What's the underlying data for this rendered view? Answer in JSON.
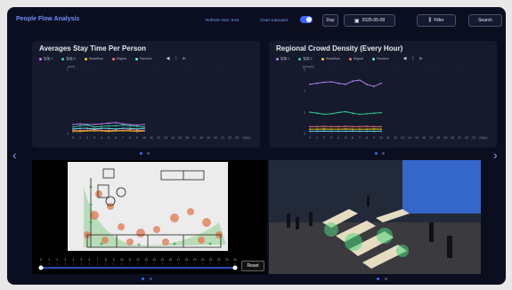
{
  "header": {
    "title": "People Flow Analysis",
    "refresh": "Refresh time: 5:54",
    "carousel_label": "Chart Carousel",
    "period": "Day",
    "date": "2025-05-08",
    "filter": "Filter",
    "search": "Search"
  },
  "colors": {
    "purple": "#c084fc",
    "green": "#34d399",
    "yellow": "#facc15",
    "red": "#f87171",
    "cyan": "#67e8f9",
    "accent": "#3a66ff"
  },
  "chart1": {
    "title": "Averages Stay Time Per Person",
    "legend": [
      "智能-1",
      "智能-2",
      "Smartflow",
      "Edgeai",
      "Pandora"
    ],
    "ylabel": "(min)",
    "xunit": "(hr)",
    "pager": "1"
  },
  "chart2": {
    "title": "Regional Crowd Density (Every Hour)",
    "legend": [
      "智能-1",
      "智能-2",
      "Smartflow",
      "Edgeai",
      "Pandora"
    ],
    "ylabel": "(people)",
    "xunit": "(hr)",
    "pager": "1"
  },
  "heatmap": {
    "reset": "Reset"
  },
  "chart_data": [
    {
      "type": "line",
      "title": "Averages Stay Time Per Person",
      "x": [
        0,
        1,
        2,
        3,
        4,
        5,
        6,
        7,
        8,
        9,
        10,
        11,
        12,
        13,
        14,
        15,
        16,
        17,
        18,
        19,
        20,
        21,
        22,
        23,
        24
      ],
      "ylim": [
        0,
        1
      ],
      "y_ticks": [
        0,
        1
      ],
      "series": [
        {
          "name": "智能-1",
          "color": "#c084fc",
          "values": [
            0.14,
            0.15,
            0.14,
            0.14,
            0.15,
            0.16,
            0.17,
            0.15,
            0.14,
            0.13,
            0.14,
            null,
            null,
            null,
            null,
            null,
            null,
            null,
            null,
            null,
            null,
            null,
            null,
            null,
            null
          ]
        },
        {
          "name": "智能-2",
          "color": "#34d399",
          "values": [
            0.1,
            0.12,
            0.13,
            0.1,
            0.11,
            0.12,
            0.12,
            0.13,
            0.12,
            0.11,
            0.1,
            null,
            null,
            null,
            null,
            null,
            null,
            null,
            null,
            null,
            null,
            null,
            null,
            null,
            null
          ]
        },
        {
          "name": "Smartflow",
          "color": "#facc15",
          "values": [
            0.03,
            0.03,
            0.04,
            0.04,
            0.04,
            0.03,
            0.04,
            0.04,
            0.04,
            0.03,
            0.04,
            null,
            null,
            null,
            null,
            null,
            null,
            null,
            null,
            null,
            null,
            null,
            null,
            null,
            null
          ]
        },
        {
          "name": "Edgeai",
          "color": "#f87171",
          "values": [
            0.05,
            0.05,
            0.05,
            0.06,
            0.05,
            0.05,
            0.05,
            0.05,
            0.06,
            0.05,
            0.05,
            null,
            null,
            null,
            null,
            null,
            null,
            null,
            null,
            null,
            null,
            null,
            null,
            null,
            null
          ]
        },
        {
          "name": "Pandora",
          "color": "#67e8f9",
          "values": [
            0.07,
            0.08,
            0.08,
            0.07,
            0.08,
            0.08,
            0.07,
            0.08,
            0.08,
            0.07,
            0.08,
            null,
            null,
            null,
            null,
            null,
            null,
            null,
            null,
            null,
            null,
            null,
            null,
            null,
            null
          ]
        }
      ]
    },
    {
      "type": "line",
      "title": "Regional Crowd Density (Every Hour)",
      "x": [
        0,
        1,
        2,
        3,
        4,
        5,
        6,
        7,
        8,
        9,
        10,
        11,
        12,
        13,
        14,
        15,
        16,
        17,
        18,
        19,
        20,
        21,
        22,
        23,
        24
      ],
      "ylim": [
        0,
        3
      ],
      "y_ticks": [
        0,
        1,
        2,
        3
      ],
      "series": [
        {
          "name": "智能-1",
          "color": "#c084fc",
          "values": [
            2.3,
            2.35,
            2.4,
            2.42,
            2.35,
            2.3,
            2.45,
            2.5,
            2.3,
            2.2,
            2.35,
            null,
            null,
            null,
            null,
            null,
            null,
            null,
            null,
            null,
            null,
            null,
            null,
            null,
            null
          ]
        },
        {
          "name": "智能-2",
          "color": "#34d399",
          "values": [
            1.0,
            0.95,
            0.9,
            0.92,
            0.98,
            1.02,
            0.95,
            0.9,
            0.92,
            0.95,
            0.97,
            null,
            null,
            null,
            null,
            null,
            null,
            null,
            null,
            null,
            null,
            null,
            null,
            null,
            null
          ]
        },
        {
          "name": "Smartflow",
          "color": "#facc15",
          "values": [
            0.2,
            0.2,
            0.21,
            0.2,
            0.2,
            0.21,
            0.2,
            0.2,
            0.2,
            0.21,
            0.2,
            null,
            null,
            null,
            null,
            null,
            null,
            null,
            null,
            null,
            null,
            null,
            null,
            null,
            null
          ]
        },
        {
          "name": "Edgeai",
          "color": "#f87171",
          "values": [
            0.32,
            0.32,
            0.33,
            0.32,
            0.32,
            0.33,
            0.32,
            0.32,
            0.33,
            0.32,
            0.32,
            null,
            null,
            null,
            null,
            null,
            null,
            null,
            null,
            null,
            null,
            null,
            null,
            null,
            null
          ]
        },
        {
          "name": "Pandora",
          "color": "#67e8f9",
          "values": [
            0.1,
            0.1,
            0.11,
            0.1,
            0.1,
            0.1,
            0.11,
            0.1,
            0.1,
            0.1,
            0.1,
            null,
            null,
            null,
            null,
            null,
            null,
            null,
            null,
            null,
            null,
            null,
            null,
            null,
            null
          ]
        }
      ]
    }
  ]
}
